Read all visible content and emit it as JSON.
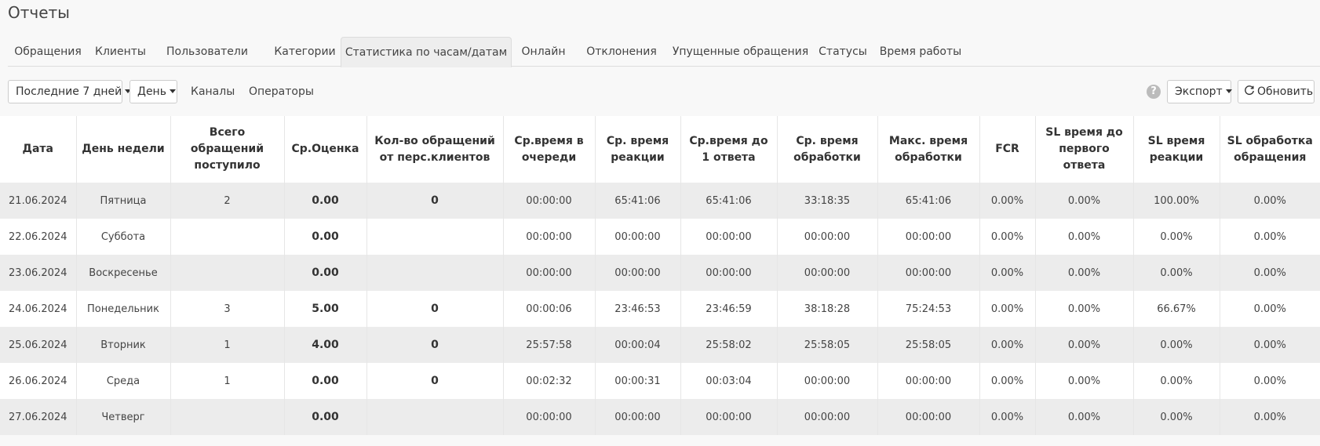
{
  "page": {
    "title": "Отчеты"
  },
  "tabs": [
    {
      "label": "Обращения"
    },
    {
      "label": "Клиенты"
    },
    {
      "label": "Пользователи"
    },
    {
      "label": "Категории"
    },
    {
      "label": "Статистика по часам/датам",
      "active": true
    },
    {
      "label": "Онлайн"
    },
    {
      "label": "Отклонения"
    },
    {
      "label": "Упущенные обращения"
    },
    {
      "label": "Статусы"
    },
    {
      "label": "Время работы"
    }
  ],
  "toolbar": {
    "period_label": "Последние 7 дней",
    "granularity_label": "День",
    "channels_label": "Каналы",
    "operators_label": "Операторы",
    "help_symbol": "?",
    "export_label": "Экспорт",
    "refresh_label": "Обновить"
  },
  "icons": {
    "help": "question-circle-icon",
    "refresh": "refresh-icon",
    "caret": "caret-down-icon"
  },
  "colors": {
    "row_odd": "#ececec",
    "row_even": "#ffffff",
    "tab_active": "#eeeeee"
  },
  "table": {
    "headers": [
      "Дата",
      "День недели",
      "Всего обращений поступило",
      "Ср.Оценка",
      "Кол-во обращений от перс.клиентов",
      "Ср.время в очереди",
      "Ср. время реакции",
      "Ср.время до 1 ответа",
      "Ср. время обработки",
      "Макс. время обработки",
      "FCR",
      "SL время до первого ответа",
      "SL время реакции",
      "SL обработка обращения"
    ],
    "rows": [
      [
        "21.06.2024",
        "Пятница",
        "2",
        "0.00",
        "0",
        "00:00:00",
        "65:41:06",
        "65:41:06",
        "33:18:35",
        "65:41:06",
        "0.00%",
        "0.00%",
        "100.00%",
        "0.00%"
      ],
      [
        "22.06.2024",
        "Суббота",
        "",
        "0.00",
        "",
        "00:00:00",
        "00:00:00",
        "00:00:00",
        "00:00:00",
        "00:00:00",
        "0.00%",
        "0.00%",
        "0.00%",
        "0.00%"
      ],
      [
        "23.06.2024",
        "Воскресенье",
        "",
        "0.00",
        "",
        "00:00:00",
        "00:00:00",
        "00:00:00",
        "00:00:00",
        "00:00:00",
        "0.00%",
        "0.00%",
        "0.00%",
        "0.00%"
      ],
      [
        "24.06.2024",
        "Понедельник",
        "3",
        "5.00",
        "0",
        "00:00:06",
        "23:46:53",
        "23:46:59",
        "38:18:28",
        "75:24:53",
        "0.00%",
        "0.00%",
        "66.67%",
        "0.00%"
      ],
      [
        "25.06.2024",
        "Вторник",
        "1",
        "4.00",
        "0",
        "25:57:58",
        "00:00:04",
        "25:58:02",
        "25:58:05",
        "25:58:05",
        "0.00%",
        "0.00%",
        "0.00%",
        "0.00%"
      ],
      [
        "26.06.2024",
        "Среда",
        "1",
        "0.00",
        "0",
        "00:02:32",
        "00:00:31",
        "00:03:04",
        "00:00:00",
        "00:00:00",
        "0.00%",
        "0.00%",
        "0.00%",
        "0.00%"
      ],
      [
        "27.06.2024",
        "Четверг",
        "",
        "0.00",
        "",
        "00:00:00",
        "00:00:00",
        "00:00:00",
        "00:00:00",
        "00:00:00",
        "0.00%",
        "0.00%",
        "0.00%",
        "0.00%"
      ]
    ]
  }
}
